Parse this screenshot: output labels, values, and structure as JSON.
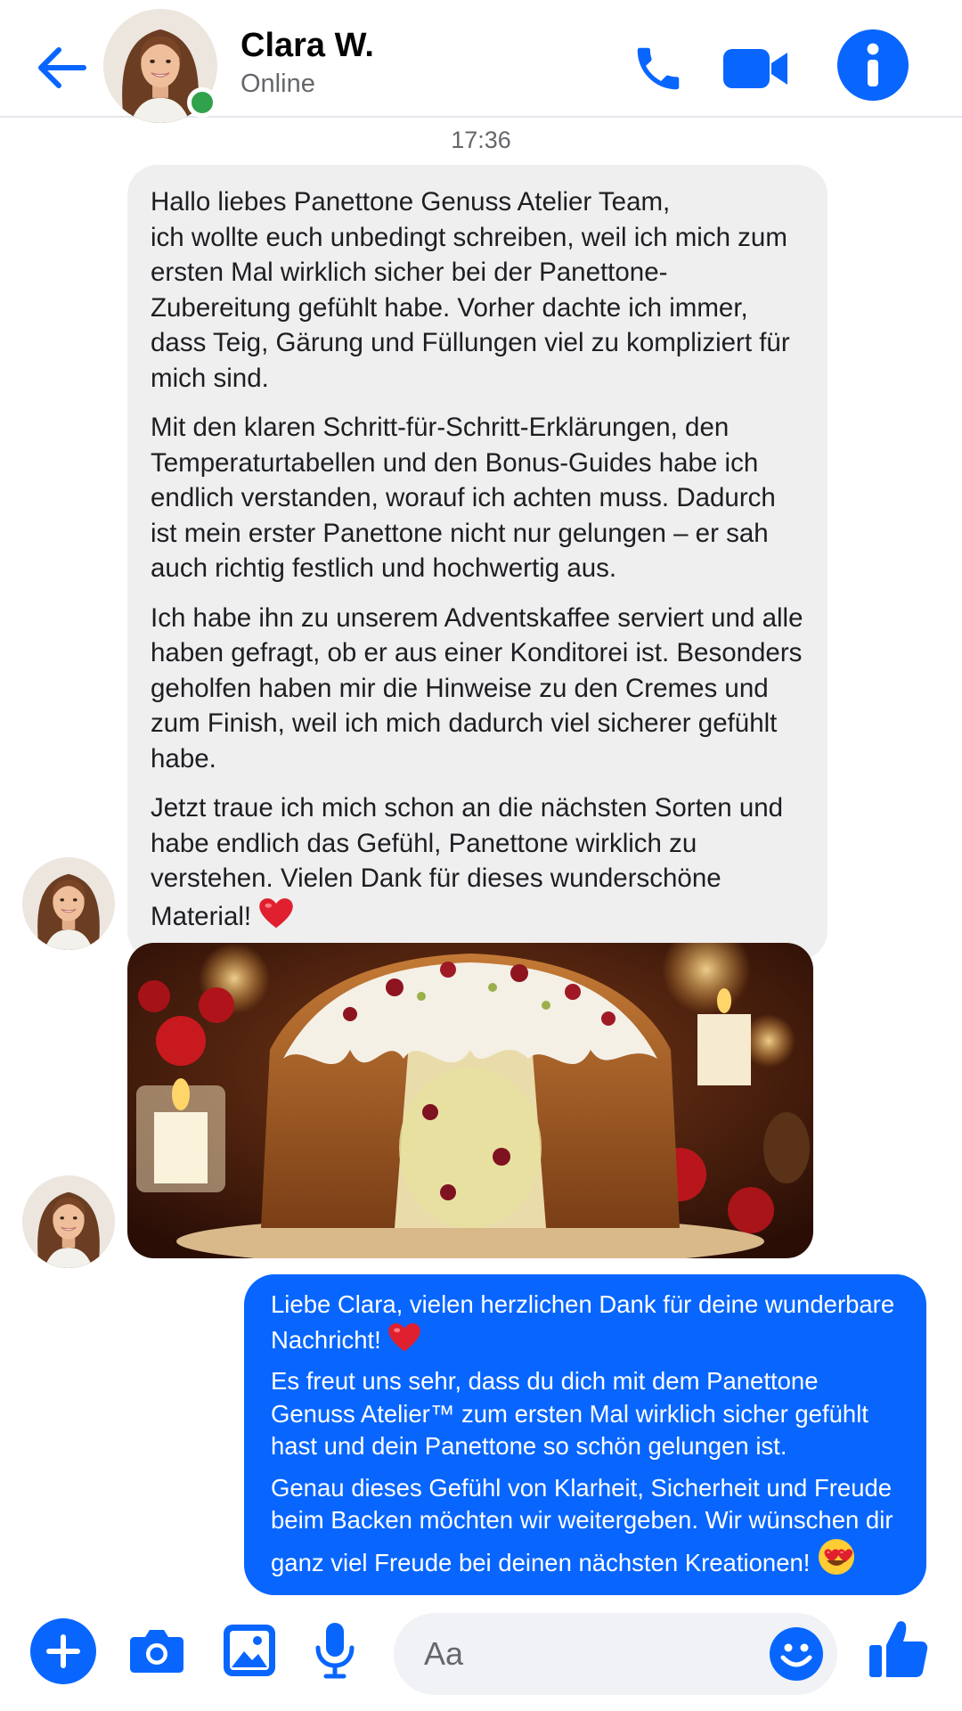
{
  "header": {
    "contact_name": "Clara W.",
    "status": "Online",
    "icons": [
      "back-arrow-icon",
      "phone-icon",
      "video-camera-icon",
      "info-icon"
    ]
  },
  "conversation": {
    "timestamp": "17:36",
    "incoming_message": {
      "paragraphs": [
        "Hallo liebes Panettone Genuss Atelier Team,",
        "ich wollte euch unbedingt schreiben, weil ich mich zum ersten Mal wirklich sicher bei der Panettone-Zubereitung gefühlt habe. Vorher dachte ich immer, dass Teig, Gärung und Füllungen viel zu kompliziert für mich sind.",
        "Mit den klaren Schritt-für-Schritt-Erklärungen, den Temperaturtabellen und den Bonus-Guides habe ich endlich verstanden, worauf ich achten muss. Dadurch ist mein erster Panettone nicht nur gelungen – er sah auch richtig festlich und hochwertig aus.",
        "Ich habe ihn zu unserem Adventskaffee serviert und alle haben gefragt, ob er aus einer Konditorei ist. Besonders geholfen haben mir die Hinweise zu den Cremes und zum Finish, weil ich mich dadurch viel sicherer gefühlt habe.",
        "Jetzt traue ich mich schon an die nächsten Sorten und habe endlich das Gefühl, Panettone wirklich zu verstehen. Vielen Dank für dieses wunderschöne Material!"
      ],
      "trailing_emoji": "red-heart-icon"
    },
    "photo": {
      "subject": "panettone with white glaze, cranberries and pistachios on a festive table"
    },
    "outgoing_message": {
      "paragraphs": [
        "Liebe Clara, vielen herzlichen Dank für deine wunderbare Nachricht!",
        "Es freut uns sehr, dass du dich mit dem Panettone Genuss Atelier™ zum ersten Mal wirklich sicher gefühlt hast und dein Panettone so schön gelungen ist.",
        "Genau dieses Gefühl von Klarheit, Sicherheit und Freude beim Backen möchten wir weitergeben. Wir wünschen dir ganz viel Freude bei deinen nächsten Kreationen!"
      ],
      "emojis": [
        "red-heart-icon",
        "heart-eyes-emoji-icon"
      ]
    }
  },
  "composer": {
    "placeholder": "Aa",
    "icons": [
      "plus-icon",
      "camera-icon",
      "image-icon",
      "microphone-icon",
      "smiley-icon",
      "thumbs-up-icon"
    ]
  },
  "colors": {
    "accent": "#0866ff",
    "incoming_bubble": "#efeff0",
    "online": "#31a24c",
    "secondary_text": "#65676b"
  }
}
